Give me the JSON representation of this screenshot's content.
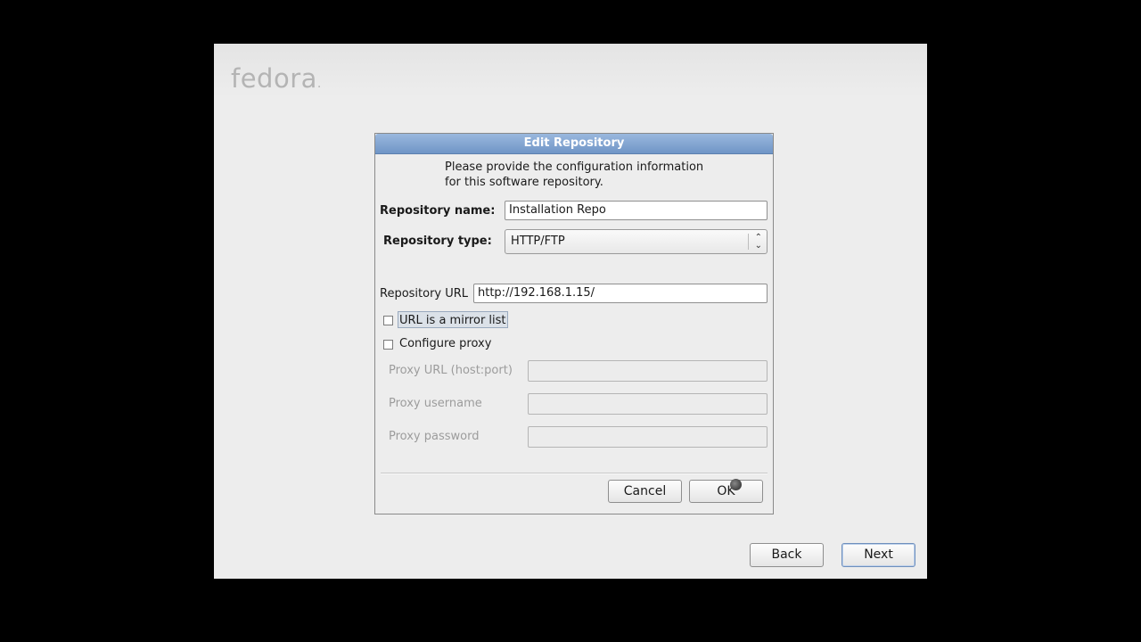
{
  "logo_text": "fedora",
  "logo_mark": ".",
  "dialog": {
    "title": "Edit Repository",
    "intro_line1": "Please provide the configuration information",
    "intro_line2": "for this software repository.",
    "repo_name_label": "Repository name:",
    "repo_name_value": "Installation Repo",
    "repo_type_label": "Repository type:",
    "repo_type_value": "HTTP/FTP",
    "repo_url_label": "Repository URL",
    "repo_url_value": "http://192.168.1.15/",
    "mirror_label": "URL is a mirror list",
    "mirror_checked": false,
    "proxy_label": "Configure proxy",
    "proxy_checked": false,
    "proxy_url_label": "Proxy URL (host:port)",
    "proxy_user_label": "Proxy username",
    "proxy_pass_label": "Proxy password",
    "cancel_label": "Cancel",
    "ok_label": "OK"
  },
  "nav": {
    "back_label": "Back",
    "next_label": "Next"
  },
  "icons": {
    "combo_arrow": "up-down-chevron-icon",
    "cursor": "busy-cursor-icon"
  }
}
